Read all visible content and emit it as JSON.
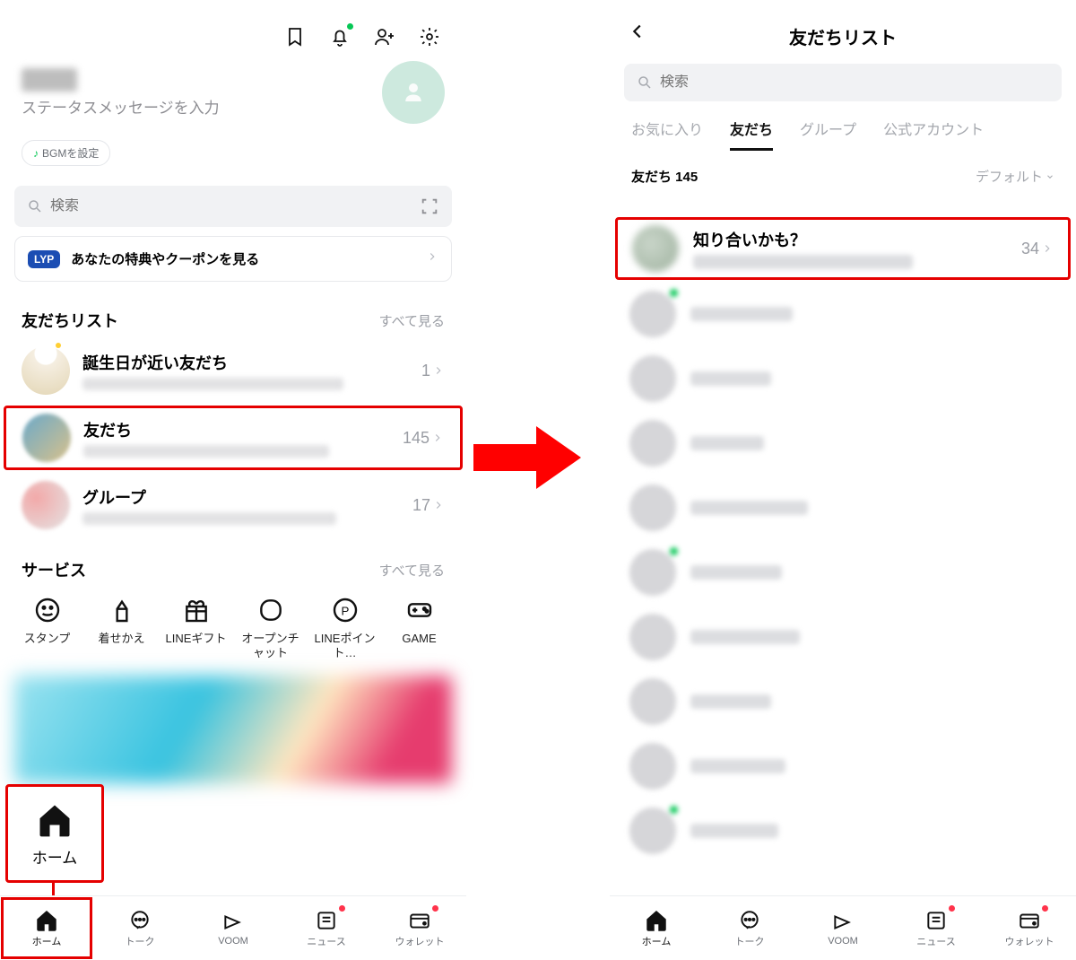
{
  "left": {
    "status_placeholder": "ステータスメッセージを入力",
    "bgm": "BGMを設定",
    "search_placeholder": "検索",
    "lyp_badge": "LYP",
    "lyp_label": "あなたの特典やクーポンを見る",
    "section_friends": "友だちリスト",
    "see_all": "すべて見る",
    "rows": [
      {
        "name": "誕生日が近い友だち",
        "count": "1"
      },
      {
        "name": "友だち",
        "count": "145"
      },
      {
        "name": "グループ",
        "count": "17"
      }
    ],
    "section_services": "サービス",
    "services": [
      "スタンプ",
      "着せかえ",
      "LINEギフト",
      "オープンチャット",
      "LINEポイント…",
      "GAME"
    ],
    "fab_home": "ホーム",
    "tabs": [
      "ホーム",
      "トーク",
      "VOOM",
      "ニュース",
      "ウォレット"
    ]
  },
  "right": {
    "title": "友だちリスト",
    "search_placeholder": "検索",
    "tabs": [
      "お気に入り",
      "友だち",
      "グループ",
      "公式アカウント"
    ],
    "active_tab": 1,
    "count_label": "友だち 145",
    "sort": "デフォルト",
    "top_row": {
      "name": "知り合いかも？",
      "count": "34"
    },
    "blur_rows": 9,
    "tabs_bottom": [
      "ホーム",
      "トーク",
      "VOOM",
      "ニュース",
      "ウォレット"
    ]
  }
}
